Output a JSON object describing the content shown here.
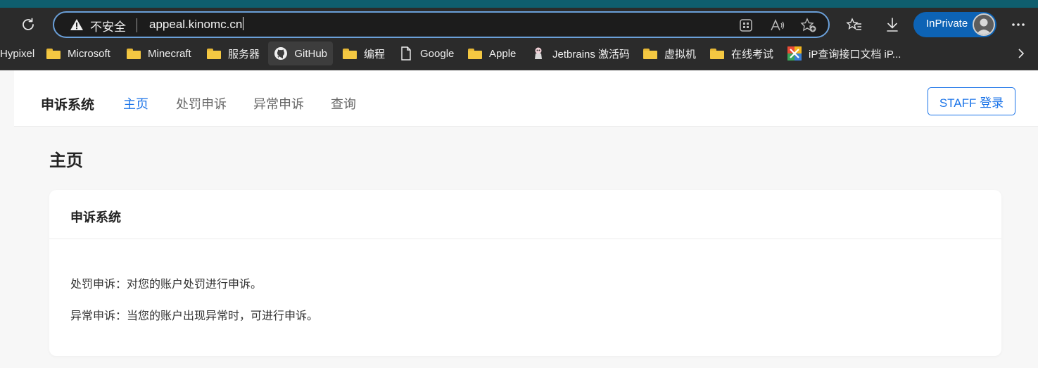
{
  "browser": {
    "address": {
      "security_label": "不安全",
      "url": "appeal.kinomc.cn"
    },
    "inprivate_label": "InPrivate",
    "bookmarks": [
      {
        "label": "Hypixel",
        "icon": "none"
      },
      {
        "label": "Microsoft",
        "icon": "folder-icon"
      },
      {
        "label": "Minecraft",
        "icon": "folder-icon"
      },
      {
        "label": "服务器",
        "icon": "folder-icon"
      },
      {
        "label": "GitHub",
        "icon": "github-icon"
      },
      {
        "label": "编程",
        "icon": "folder-icon"
      },
      {
        "label": "Google",
        "icon": "page-icon"
      },
      {
        "label": "Apple",
        "icon": "folder-icon"
      },
      {
        "label": "Jetbrains 激活码",
        "icon": "jetbrains-icon"
      },
      {
        "label": "虚拟机",
        "icon": "folder-icon"
      },
      {
        "label": "在线考试",
        "icon": "folder-icon"
      },
      {
        "label": "iP查询接口文档 iP...",
        "icon": "ip-lookup-icon"
      }
    ],
    "colors": {
      "chrome": "#2b2b2b",
      "address_border": "#6a9fd8",
      "inprivate": "#0d63b5"
    }
  },
  "site": {
    "brand": "申诉系统",
    "nav": [
      {
        "label": "主页",
        "active": true
      },
      {
        "label": "处罚申诉",
        "active": false
      },
      {
        "label": "异常申诉",
        "active": false
      },
      {
        "label": "查询",
        "active": false
      }
    ],
    "staff_login": "STAFF 登录",
    "page_title": "主页",
    "card": {
      "title": "申诉系统",
      "lines": [
        "处罚申诉：对您的账户处罚进行申诉。",
        "异常申诉：当您的账户出现异常时，可进行申诉。"
      ]
    },
    "colors": {
      "accent": "#1a73e8"
    }
  }
}
